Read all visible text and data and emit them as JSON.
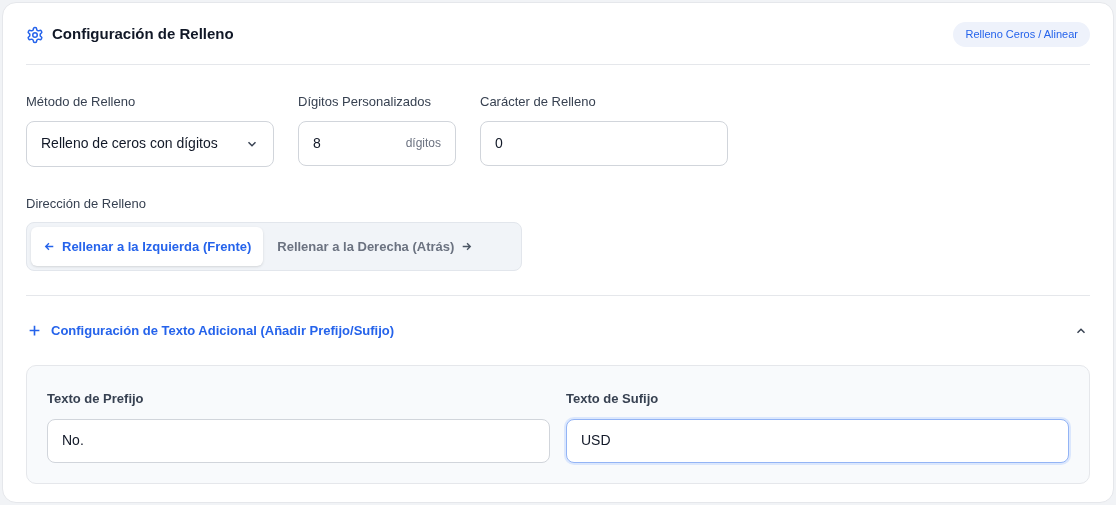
{
  "header": {
    "title": "Configuración de Relleno",
    "badge": "Relleno Ceros / Alinear"
  },
  "method": {
    "label": "Método de Relleno",
    "value": "Relleno de ceros con dígitos"
  },
  "digits": {
    "label": "Dígitos Personalizados",
    "value": "8",
    "unit": "dígitos"
  },
  "char": {
    "label": "Carácter de Relleno",
    "value": "0"
  },
  "direction": {
    "label": "Dirección de Relleno",
    "options": [
      {
        "label": "Rellenar a la Izquierda (Frente)",
        "kind": "back",
        "selected": true
      },
      {
        "label": "Rellenar a la Derecha (Atrás)",
        "kind": "forward",
        "selected": false
      }
    ]
  },
  "extra": {
    "title": "Configuración de Texto Adicional (Añadir Prefijo/Sufijo)",
    "expanded": true,
    "fields": [
      {
        "label": "Texto de Prefijo",
        "value": "No.",
        "focused": false
      },
      {
        "label": "Texto de Sufijo",
        "value": "USD",
        "focused": true
      }
    ]
  }
}
